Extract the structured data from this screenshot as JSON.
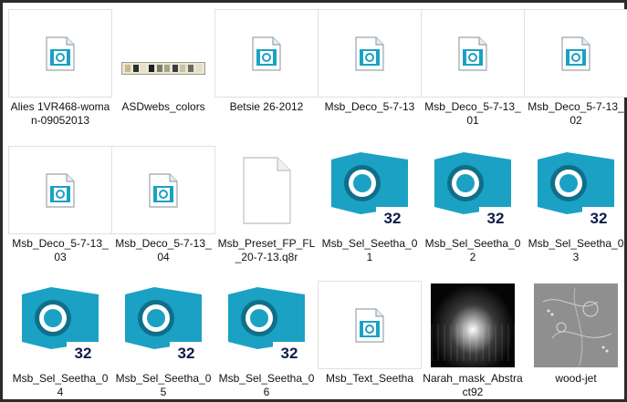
{
  "items": [
    {
      "name": "file-alies",
      "label": "Alies 1VR468-woman-09052013",
      "kind": "pic"
    },
    {
      "name": "file-asdwebs-colors",
      "label": "ASDwebs_colors",
      "kind": "colors"
    },
    {
      "name": "file-betsie",
      "label": "Betsie 26-2012",
      "kind": "pic"
    },
    {
      "name": "file-msb-deco-3",
      "label": "Msb_Deco_5-7-13",
      "kind": "pic"
    },
    {
      "name": "file-msb-deco-3-01",
      "label": "Msb_Deco_5-7-13_01",
      "kind": "pic"
    },
    {
      "name": "file-msb-deco-3-02",
      "label": "Msb_Deco_5-7-13_02",
      "kind": "pic"
    },
    {
      "name": "file-msb-deco-3-03",
      "label": "Msb_Deco_5-7-13_03",
      "kind": "pic"
    },
    {
      "name": "file-msb-deco-3-04",
      "label": "Msb_Deco_5-7-13_04",
      "kind": "pic"
    },
    {
      "name": "file-msb-preset",
      "label": "Msb_Preset_FP_FL_20-7-13.q8r",
      "kind": "doc"
    },
    {
      "name": "file-msb-sel-01",
      "label": "Msb_Sel_Seetha_01",
      "kind": "app"
    },
    {
      "name": "file-msb-sel-02",
      "label": "Msb_Sel_Seetha_02",
      "kind": "app"
    },
    {
      "name": "file-msb-sel-03",
      "label": "Msb_Sel_Seetha_03",
      "kind": "app"
    },
    {
      "name": "file-msb-sel-04",
      "label": "Msb_Sel_Seetha_04",
      "kind": "app"
    },
    {
      "name": "file-msb-sel-05",
      "label": "Msb_Sel_Seetha_05",
      "kind": "app"
    },
    {
      "name": "file-msb-sel-06",
      "label": "Msb_Sel_Seetha_06",
      "kind": "app"
    },
    {
      "name": "file-msb-text",
      "label": "Msb_Text_Seetha",
      "kind": "pic"
    },
    {
      "name": "file-narah-mask",
      "label": "Narah_mask_Abstract92",
      "kind": "mask"
    },
    {
      "name": "file-wood-jet",
      "label": "wood-jet",
      "kind": "wood"
    }
  ],
  "app_badge": "32",
  "colors": {
    "accent": "#1ba1c3",
    "accent_dark": "#0f6f8a",
    "badge_text": "#0d1b4a"
  }
}
